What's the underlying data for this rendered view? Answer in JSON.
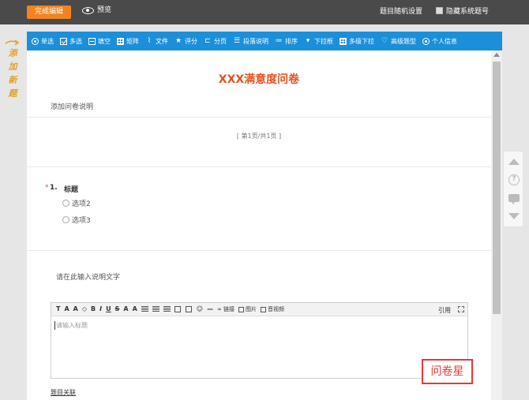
{
  "topbar": {
    "finish_label": "完成编辑",
    "preview_label": "预览",
    "random_setting_label": "题目随机设置",
    "hide_number_label": "隐藏系统题号"
  },
  "side_note": {
    "text": "添加新题"
  },
  "toolbar": {
    "items": [
      {
        "label": "单选",
        "icon": "radio-icon"
      },
      {
        "label": "多选",
        "icon": "checkbox-icon"
      },
      {
        "label": "填空",
        "icon": "fill-blank-icon"
      },
      {
        "label": "矩阵",
        "icon": "matrix-icon"
      },
      {
        "label": "文件",
        "icon": "paperclip-icon"
      },
      {
        "label": "评分",
        "icon": "rating-icon"
      },
      {
        "label": "分页",
        "icon": "page-break-icon"
      },
      {
        "label": "段落说明",
        "icon": "paragraph-icon"
      },
      {
        "label": "排序",
        "icon": "sort-icon"
      },
      {
        "label": "下拉框",
        "icon": "dropdown-icon"
      },
      {
        "label": "多级下拉",
        "icon": "multilevel-dropdown-icon"
      },
      {
        "label": "高级题型",
        "icon": "advanced-icon"
      },
      {
        "label": "个人信息",
        "icon": "user-icon"
      }
    ]
  },
  "survey": {
    "title": "XXX满意度问卷",
    "description": "添加问卷说明",
    "page_indicator": "[ 第1页/共1页 ]",
    "question": {
      "required_mark": "*",
      "number": "1.",
      "title": "标题",
      "options": [
        "选项2",
        "选项3"
      ]
    },
    "desc_placeholder": "请在此输入说明文字"
  },
  "editor": {
    "toolbar_buttons": [
      "T",
      "A",
      "A",
      "B",
      "I",
      "U",
      "S",
      "A",
      "A"
    ],
    "link_label": "链接",
    "image_label": "图片",
    "audio_label": "音视频",
    "cite_label": "引用",
    "placeholder": "请输入标题"
  },
  "watermark": "问卷星",
  "related_label": "题目关联",
  "colors": {
    "topbar": "#4a4a4a",
    "accent_orange": "#f3831e",
    "toolbar_blue": "#1c8fda",
    "title_red": "#e0541f"
  }
}
